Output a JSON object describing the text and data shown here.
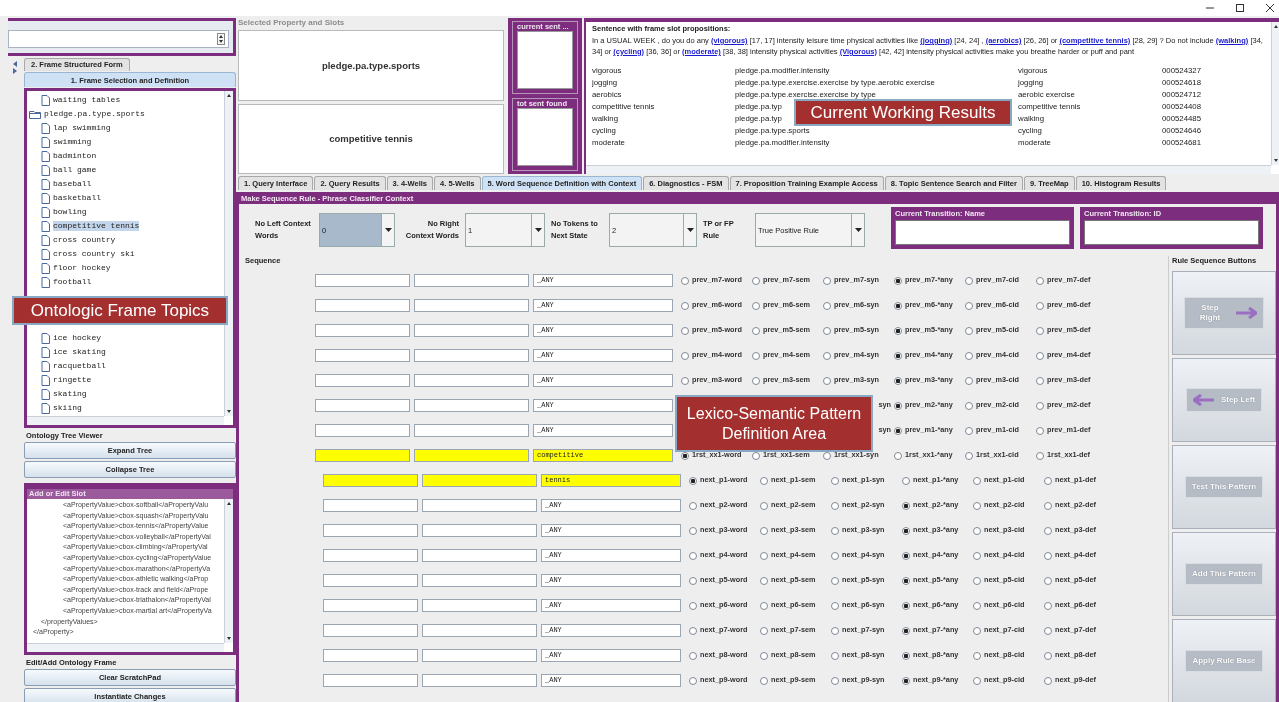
{
  "left_panel": {
    "tabs": [
      {
        "label": "2. Frame Structured Form",
        "selected": false
      },
      {
        "label": "1. Frame Selection and Definition",
        "selected": true
      }
    ],
    "tree": [
      {
        "label": "waiting tables",
        "kind": "leaf",
        "selected": false
      },
      {
        "label": "pledge.pa.type.sports",
        "kind": "folder",
        "selected": false,
        "expanded": true,
        "children": [
          {
            "label": "lap swimming",
            "selected": false
          },
          {
            "label": "swimming",
            "selected": false
          },
          {
            "label": "badminton",
            "selected": false
          },
          {
            "label": "ball game",
            "selected": false
          },
          {
            "label": "baseball",
            "selected": false
          },
          {
            "label": "basketball",
            "selected": false
          },
          {
            "label": "bowling",
            "selected": false
          },
          {
            "label": "competitive tennis",
            "selected": true
          },
          {
            "label": "cross country",
            "selected": false
          },
          {
            "label": "cross country ski",
            "selected": false
          },
          {
            "label": "floor hockey",
            "selected": false
          },
          {
            "label": "football",
            "selected": false
          },
          {
            "label": "ice hockey",
            "selected": false
          },
          {
            "label": "ice skating",
            "selected": false
          },
          {
            "label": "racquetball",
            "selected": false
          },
          {
            "label": "ringette",
            "selected": false
          },
          {
            "label": "skating",
            "selected": false
          },
          {
            "label": "skiing",
            "selected": false
          }
        ]
      }
    ],
    "callout": "Ontologic Frame Topics",
    "tree_viewer": {
      "title": "Ontology Tree Viewer",
      "buttons": [
        "Expand Tree",
        "Collapse Tree"
      ]
    },
    "slot_editor": {
      "title": "Add or Edit Slot",
      "lines": [
        {
          "kind": "value",
          "text": "<aPropertyValue>cbox-softball</aPropertyValu"
        },
        {
          "kind": "value",
          "text": "<aPropertyValue>cbox-squash</aPropertyValu"
        },
        {
          "kind": "value",
          "text": "<aPropertyValue>cbox-tennis</aPropertyValue"
        },
        {
          "kind": "value",
          "text": "<aPropertyValue>cbox-volleyball</aPropertyVal"
        },
        {
          "kind": "value",
          "text": "<aPropertyValue>cbox-climbing</aPropertyVal"
        },
        {
          "kind": "value",
          "text": "<aPropertyValue>cbox-cycling</aPropertyValue"
        },
        {
          "kind": "value",
          "text": "<aPropertyValue>cbox-marathon</aPropertyVa"
        },
        {
          "kind": "value",
          "text": "<aPropertyValue>cbox-athletic walking</aProp"
        },
        {
          "kind": "value",
          "text": "<aPropertyValue>cbox-track and field</aPrope"
        },
        {
          "kind": "value",
          "text": "<aPropertyValue>cbox-triathalon</aPropertyVal"
        },
        {
          "kind": "value",
          "text": "<aPropertyValue>cbox-martial art</aPropertyVa"
        },
        {
          "kind": "list-end",
          "text": "</propertyValues>"
        },
        {
          "kind": "property-end",
          "text": "</aProperty>"
        }
      ]
    },
    "frame_editor": {
      "title": "Edit/Add Ontology Frame",
      "buttons": [
        "Clear ScratchPad",
        "Instantiate Changes"
      ]
    }
  },
  "selected_property": {
    "title": "Selected Property and Slots",
    "property": "pledge.pa.type.sports",
    "slot": "competitive tennis"
  },
  "counters": [
    {
      "title": "current sent ..."
    },
    {
      "title": "tot sent found"
    }
  ],
  "results": {
    "title": "Sentence with frame slot propositions:",
    "sentence": [
      {
        "kind": "plain",
        "text": "In a USUAL WEEK , do you do any "
      },
      {
        "kind": "link",
        "text": "(vigorous)"
      },
      {
        "kind": "plain",
        "text": " [17, 17] intensity leisure time physical activities like "
      },
      {
        "kind": "link",
        "text": "(jogging)"
      },
      {
        "kind": "plain",
        "text": " [24, 24] , "
      },
      {
        "kind": "link",
        "text": "(aerobics)"
      },
      {
        "kind": "plain",
        "text": " [26, 26] or "
      },
      {
        "kind": "link",
        "text": "(competitive tennis)"
      },
      {
        "kind": "plain",
        "text": " [28, 29] ? Do not include "
      },
      {
        "kind": "link",
        "text": "(walking)"
      },
      {
        "kind": "plain",
        "text": " [34, 34] or "
      },
      {
        "kind": "link",
        "text": "(cycling)"
      },
      {
        "kind": "plain",
        "text": " [36, 36] or "
      },
      {
        "kind": "link",
        "text": "(moderate)"
      },
      {
        "kind": "plain",
        "text": " [38, 38] intensity physical activities "
      },
      {
        "kind": "link",
        "text": "(Vigorous)"
      },
      {
        "kind": "plain",
        "text": " [42, 42] intensity physical activities make you breathe harder or puff and pant"
      }
    ],
    "rows": [
      [
        "vigorous",
        "pledge.pa.modifier.intensity",
        "vigorous",
        "000524327"
      ],
      [
        "jogging",
        "pledge.pa.type.exercise.exercise by type.aerobic exercise",
        "jogging",
        "000524618"
      ],
      [
        "aerobics",
        "pledge.pa.type.exercise.exercise by type",
        "aerobic exercise",
        "000524712"
      ],
      [
        "competitive tennis",
        "pledge.pa.typ",
        "competitive tennis",
        "000524408"
      ],
      [
        "walking",
        "pledge.pa.typ",
        "walking",
        "000524485"
      ],
      [
        "cycling",
        "pledge.pa.type.sports",
        "cycling",
        "000524646"
      ],
      [
        "moderate",
        "pledge.pa.modifier.intensity",
        "moderate",
        "000524681"
      ]
    ],
    "callout": "Current Working Results"
  },
  "main_tabs": [
    {
      "label": "1. Query Interface",
      "selected": false
    },
    {
      "label": "2. Query Results",
      "selected": false
    },
    {
      "label": "3. 4-Wells",
      "selected": false
    },
    {
      "label": "4. 5-Wells",
      "selected": false
    },
    {
      "label": "5. Word Sequence Definition with Context",
      "selected": true
    },
    {
      "label": "6. Diagnostics - FSM",
      "selected": false
    },
    {
      "label": "7. Proposition Training Example Access",
      "selected": false
    },
    {
      "label": "8. Topic Sentence Search and Filter",
      "selected": false
    },
    {
      "label": "9. TreeMap",
      "selected": false
    },
    {
      "label": "10. Histogram Results",
      "selected": false
    }
  ],
  "rule_form": {
    "title": "Make Sequence Rule - Phrase Classifier Context",
    "combos": [
      {
        "label": "No Left Context Words",
        "value": "0",
        "focused": true
      },
      {
        "label": "No Right Context Words",
        "value": "1",
        "focused": false
      },
      {
        "label": "No Tokens to Next State",
        "value": "2",
        "focused": false
      },
      {
        "label": "TP or FP Rule",
        "value": "True Positive Rule",
        "focused": false
      }
    ],
    "transition": [
      {
        "title": "Current Transition: Name"
      },
      {
        "title": "Current Transition:  ID"
      }
    ],
    "sequence": {
      "title": "Sequence",
      "callout": "Lexico-Semantic Pattern Definition Area",
      "rows": [
        {
          "kind": "prev",
          "highlighted": false,
          "value": "_ANY",
          "options": [
            {
              "kind": "radio",
              "label": "prev_m7-word",
              "selected": false
            },
            {
              "kind": "radio",
              "label": "prev_m7-sem",
              "selected": false
            },
            {
              "kind": "radio",
              "label": "prev_m7-syn",
              "selected": false
            },
            {
              "kind": "radio",
              "label": "prev_m7-*any",
              "selected": true
            },
            {
              "kind": "radio",
              "label": "prev_m7-cid",
              "selected": false
            },
            {
              "kind": "radio",
              "label": "prev_m7-def",
              "selected": false
            }
          ]
        },
        {
          "kind": "prev",
          "highlighted": false,
          "value": "_ANY",
          "options": [
            {
              "kind": "radio",
              "label": "prev_m6-word",
              "selected": false
            },
            {
              "kind": "radio",
              "label": "prev_m6-sem",
              "selected": false
            },
            {
              "kind": "radio",
              "label": "prev_m6-syn",
              "selected": false
            },
            {
              "kind": "radio",
              "label": "prev_m6-*any",
              "selected": true
            },
            {
              "kind": "radio",
              "label": "prev_m6-cid",
              "selected": false
            },
            {
              "kind": "radio",
              "label": "prev_m6-def",
              "selected": false
            }
          ]
        },
        {
          "kind": "prev",
          "highlighted": false,
          "value": "_ANY",
          "options": [
            {
              "kind": "radio",
              "label": "prev_m5-word",
              "selected": false
            },
            {
              "kind": "radio",
              "label": "prev_m5-sem",
              "selected": false
            },
            {
              "kind": "radio",
              "label": "prev_m5-syn",
              "selected": false
            },
            {
              "kind": "radio",
              "label": "prev_m5-*any",
              "selected": true
            },
            {
              "kind": "radio",
              "label": "prev_m5-cid",
              "selected": false
            },
            {
              "kind": "radio",
              "label": "prev_m5-def",
              "selected": false
            }
          ]
        },
        {
          "kind": "prev",
          "highlighted": false,
          "value": "_ANY",
          "options": [
            {
              "kind": "radio",
              "label": "prev_m4-word",
              "selected": false
            },
            {
              "kind": "radio",
              "label": "prev_m4-sem",
              "selected": false
            },
            {
              "kind": "radio",
              "label": "prev_m4-syn",
              "selected": false
            },
            {
              "kind": "radio",
              "label": "prev_m4-*any",
              "selected": true
            },
            {
              "kind": "radio",
              "label": "prev_m4-cid",
              "selected": false
            },
            {
              "kind": "radio",
              "label": "prev_m4-def",
              "selected": false
            }
          ]
        },
        {
          "kind": "prev",
          "highlighted": false,
          "value": "_ANY",
          "options": [
            {
              "kind": "radio",
              "label": "prev_m3-word",
              "selected": false
            },
            {
              "kind": "radio",
              "label": "prev_m3-sem",
              "selected": false
            },
            {
              "kind": "radio",
              "label": "prev_m3-syn",
              "selected": false
            },
            {
              "kind": "radio",
              "label": "prev_m3-*any",
              "selected": true
            },
            {
              "kind": "radio",
              "label": "prev_m3-cid",
              "selected": false
            },
            {
              "kind": "radio",
              "label": "prev_m3-def",
              "selected": false
            }
          ]
        },
        {
          "kind": "prev",
          "highlighted": false,
          "value": "_ANY",
          "options": [
            {
              "kind": "cut",
              "label": "syn"
            },
            {
              "kind": "radio",
              "label": "prev_m2-*any",
              "selected": true
            },
            {
              "kind": "radio",
              "label": "prev_m2-cid",
              "selected": false
            },
            {
              "kind": "radio",
              "label": "prev_m2-def",
              "selected": false
            }
          ]
        },
        {
          "kind": "prev",
          "highlighted": false,
          "value": "_ANY",
          "options": [
            {
              "kind": "cut",
              "label": "syn"
            },
            {
              "kind": "radio",
              "label": "prev_m1-*any",
              "selected": true
            },
            {
              "kind": "radio",
              "label": "prev_m1-cid",
              "selected": false
            },
            {
              "kind": "radio",
              "label": "prev_m1-def",
              "selected": false
            }
          ]
        },
        {
          "kind": "first",
          "highlighted": true,
          "value": "competitive",
          "options": [
            {
              "kind": "radio",
              "label": "1rst_xx1-word",
              "selected": true
            },
            {
              "kind": "radio",
              "label": "1rst_xx1-sem",
              "selected": false
            },
            {
              "kind": "radio",
              "label": "1rst_xx1-syn",
              "selected": false
            },
            {
              "kind": "radio",
              "label": "1rst_xx1-*any",
              "selected": false
            },
            {
              "kind": "radio",
              "label": "1rst_xx1-cid",
              "selected": false
            },
            {
              "kind": "radio",
              "label": "1rst_xx1-def",
              "selected": false
            }
          ]
        },
        {
          "kind": "next",
          "highlighted": true,
          "value": "tennis",
          "options": [
            {
              "kind": "radio",
              "label": "next_p1-word",
              "selected": true
            },
            {
              "kind": "radio",
              "label": "next_p1-sem",
              "selected": false
            },
            {
              "kind": "radio",
              "label": "next_p1-syn",
              "selected": false
            },
            {
              "kind": "radio",
              "label": "next_p1-*any",
              "selected": false
            },
            {
              "kind": "radio",
              "label": "next_p1-cid",
              "selected": false
            },
            {
              "kind": "radio",
              "label": "next_p1-def",
              "selected": false
            }
          ]
        },
        {
          "kind": "next",
          "highlighted": false,
          "value": "_ANY",
          "options": [
            {
              "kind": "radio",
              "label": "next_p2-word",
              "selected": false
            },
            {
              "kind": "radio",
              "label": "next_p2-sem",
              "selected": false
            },
            {
              "kind": "radio",
              "label": "next_p2-syn",
              "selected": false
            },
            {
              "kind": "radio",
              "label": "next_p2-*any",
              "selected": true
            },
            {
              "kind": "radio",
              "label": "next_p2-cid",
              "selected": false
            },
            {
              "kind": "radio",
              "label": "next_p2-def",
              "selected": false
            }
          ]
        },
        {
          "kind": "next",
          "highlighted": false,
          "value": "_ANY",
          "options": [
            {
              "kind": "radio",
              "label": "next_p3-word",
              "selected": false
            },
            {
              "kind": "radio",
              "label": "next_p3-sem",
              "selected": false
            },
            {
              "kind": "radio",
              "label": "next_p3-syn",
              "selected": false
            },
            {
              "kind": "radio",
              "label": "next_p3-*any",
              "selected": true
            },
            {
              "kind": "radio",
              "label": "next_p3-cid",
              "selected": false
            },
            {
              "kind": "radio",
              "label": "next_p3-def",
              "selected": false
            }
          ]
        },
        {
          "kind": "next",
          "highlighted": false,
          "value": "_ANY",
          "options": [
            {
              "kind": "radio",
              "label": "next_p4-word",
              "selected": false
            },
            {
              "kind": "radio",
              "label": "next_p4-sem",
              "selected": false
            },
            {
              "kind": "radio",
              "label": "next_p4-syn",
              "selected": false
            },
            {
              "kind": "radio",
              "label": "next_p4-*any",
              "selected": true
            },
            {
              "kind": "radio",
              "label": "next_p4-cid",
              "selected": false
            },
            {
              "kind": "radio",
              "label": "next_p4-def",
              "selected": false
            }
          ]
        },
        {
          "kind": "next",
          "highlighted": false,
          "value": "_ANY",
          "options": [
            {
              "kind": "radio",
              "label": "next_p5-word",
              "selected": false
            },
            {
              "kind": "radio",
              "label": "next_p5-sem",
              "selected": false
            },
            {
              "kind": "radio",
              "label": "next_p5-syn",
              "selected": false
            },
            {
              "kind": "radio",
              "label": "next_p5-*any",
              "selected": true
            },
            {
              "kind": "radio",
              "label": "next_p5-cid",
              "selected": false
            },
            {
              "kind": "radio",
              "label": "next_p5-def",
              "selected": false
            }
          ]
        },
        {
          "kind": "next",
          "highlighted": false,
          "value": "_ANY",
          "options": [
            {
              "kind": "radio",
              "label": "next_p6-word",
              "selected": false
            },
            {
              "kind": "radio",
              "label": "next_p6-sem",
              "selected": false
            },
            {
              "kind": "radio",
              "label": "next_p6-syn",
              "selected": false
            },
            {
              "kind": "radio",
              "label": "next_p6-*any",
              "selected": true
            },
            {
              "kind": "radio",
              "label": "next_p6-cid",
              "selected": false
            },
            {
              "kind": "radio",
              "label": "next_p6-def",
              "selected": false
            }
          ]
        },
        {
          "kind": "next",
          "highlighted": false,
          "value": "_ANY",
          "options": [
            {
              "kind": "radio",
              "label": "next_p7-word",
              "selected": false
            },
            {
              "kind": "radio",
              "label": "next_p7-sem",
              "selected": false
            },
            {
              "kind": "radio",
              "label": "next_p7-syn",
              "selected": false
            },
            {
              "kind": "radio",
              "label": "next_p7-*any",
              "selected": true
            },
            {
              "kind": "radio",
              "label": "next_p7-cid",
              "selected": false
            },
            {
              "kind": "radio",
              "label": "next_p7-def",
              "selected": false
            }
          ]
        },
        {
          "kind": "next",
          "highlighted": false,
          "value": "_ANY",
          "options": [
            {
              "kind": "radio",
              "label": "next_p8-word",
              "selected": false
            },
            {
              "kind": "radio",
              "label": "next_p8-sem",
              "selected": false
            },
            {
              "kind": "radio",
              "label": "next_p8-syn",
              "selected": false
            },
            {
              "kind": "radio",
              "label": "next_p8-*any",
              "selected": true
            },
            {
              "kind": "radio",
              "label": "next_p8-cid",
              "selected": false
            },
            {
              "kind": "radio",
              "label": "next_p8-def",
              "selected": false
            }
          ]
        },
        {
          "kind": "next",
          "highlighted": false,
          "value": "_ANY",
          "options": [
            {
              "kind": "radio",
              "label": "next_p9-word",
              "selected": false
            },
            {
              "kind": "radio",
              "label": "next_p9-sem",
              "selected": false
            },
            {
              "kind": "radio",
              "label": "next_p9-syn",
              "selected": false
            },
            {
              "kind": "radio",
              "label": "next_p9-*any",
              "selected": true
            },
            {
              "kind": "radio",
              "label": "next_p9-cid",
              "selected": false
            },
            {
              "kind": "radio",
              "label": "next_p9-def",
              "selected": false
            }
          ]
        }
      ]
    },
    "rule_buttons": {
      "title": "Rule Sequence Buttons",
      "buttons": [
        {
          "label": "Step Right",
          "kind": "right"
        },
        {
          "label": "Step Left",
          "kind": "left"
        },
        {
          "label": "Test This Pattern",
          "kind": "plain"
        },
        {
          "label": "Add This Pattern",
          "kind": "plain"
        },
        {
          "label": "Apply Rule Base",
          "kind": "plain"
        }
      ]
    }
  }
}
